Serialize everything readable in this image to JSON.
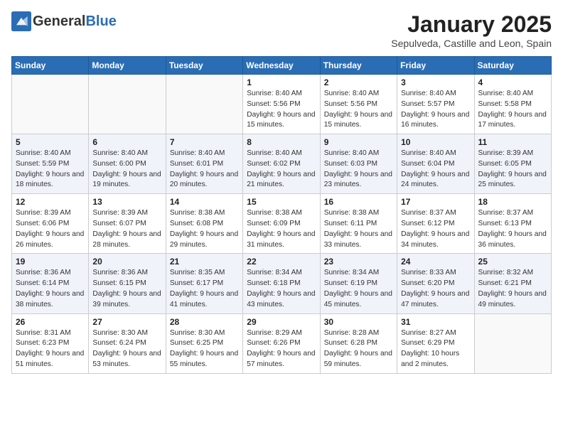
{
  "logo": {
    "general": "General",
    "blue": "Blue"
  },
  "header": {
    "month": "January 2025",
    "location": "Sepulveda, Castille and Leon, Spain"
  },
  "weekdays": [
    "Sunday",
    "Monday",
    "Tuesday",
    "Wednesday",
    "Thursday",
    "Friday",
    "Saturday"
  ],
  "weeks": [
    [
      {
        "day": "",
        "content": ""
      },
      {
        "day": "",
        "content": ""
      },
      {
        "day": "",
        "content": ""
      },
      {
        "day": "1",
        "content": "Sunrise: 8:40 AM\nSunset: 5:56 PM\nDaylight: 9 hours and 15 minutes."
      },
      {
        "day": "2",
        "content": "Sunrise: 8:40 AM\nSunset: 5:56 PM\nDaylight: 9 hours and 15 minutes."
      },
      {
        "day": "3",
        "content": "Sunrise: 8:40 AM\nSunset: 5:57 PM\nDaylight: 9 hours and 16 minutes."
      },
      {
        "day": "4",
        "content": "Sunrise: 8:40 AM\nSunset: 5:58 PM\nDaylight: 9 hours and 17 minutes."
      }
    ],
    [
      {
        "day": "5",
        "content": "Sunrise: 8:40 AM\nSunset: 5:59 PM\nDaylight: 9 hours and 18 minutes."
      },
      {
        "day": "6",
        "content": "Sunrise: 8:40 AM\nSunset: 6:00 PM\nDaylight: 9 hours and 19 minutes."
      },
      {
        "day": "7",
        "content": "Sunrise: 8:40 AM\nSunset: 6:01 PM\nDaylight: 9 hours and 20 minutes."
      },
      {
        "day": "8",
        "content": "Sunrise: 8:40 AM\nSunset: 6:02 PM\nDaylight: 9 hours and 21 minutes."
      },
      {
        "day": "9",
        "content": "Sunrise: 8:40 AM\nSunset: 6:03 PM\nDaylight: 9 hours and 23 minutes."
      },
      {
        "day": "10",
        "content": "Sunrise: 8:40 AM\nSunset: 6:04 PM\nDaylight: 9 hours and 24 minutes."
      },
      {
        "day": "11",
        "content": "Sunrise: 8:39 AM\nSunset: 6:05 PM\nDaylight: 9 hours and 25 minutes."
      }
    ],
    [
      {
        "day": "12",
        "content": "Sunrise: 8:39 AM\nSunset: 6:06 PM\nDaylight: 9 hours and 26 minutes."
      },
      {
        "day": "13",
        "content": "Sunrise: 8:39 AM\nSunset: 6:07 PM\nDaylight: 9 hours and 28 minutes."
      },
      {
        "day": "14",
        "content": "Sunrise: 8:38 AM\nSunset: 6:08 PM\nDaylight: 9 hours and 29 minutes."
      },
      {
        "day": "15",
        "content": "Sunrise: 8:38 AM\nSunset: 6:09 PM\nDaylight: 9 hours and 31 minutes."
      },
      {
        "day": "16",
        "content": "Sunrise: 8:38 AM\nSunset: 6:11 PM\nDaylight: 9 hours and 33 minutes."
      },
      {
        "day": "17",
        "content": "Sunrise: 8:37 AM\nSunset: 6:12 PM\nDaylight: 9 hours and 34 minutes."
      },
      {
        "day": "18",
        "content": "Sunrise: 8:37 AM\nSunset: 6:13 PM\nDaylight: 9 hours and 36 minutes."
      }
    ],
    [
      {
        "day": "19",
        "content": "Sunrise: 8:36 AM\nSunset: 6:14 PM\nDaylight: 9 hours and 38 minutes."
      },
      {
        "day": "20",
        "content": "Sunrise: 8:36 AM\nSunset: 6:15 PM\nDaylight: 9 hours and 39 minutes."
      },
      {
        "day": "21",
        "content": "Sunrise: 8:35 AM\nSunset: 6:17 PM\nDaylight: 9 hours and 41 minutes."
      },
      {
        "day": "22",
        "content": "Sunrise: 8:34 AM\nSunset: 6:18 PM\nDaylight: 9 hours and 43 minutes."
      },
      {
        "day": "23",
        "content": "Sunrise: 8:34 AM\nSunset: 6:19 PM\nDaylight: 9 hours and 45 minutes."
      },
      {
        "day": "24",
        "content": "Sunrise: 8:33 AM\nSunset: 6:20 PM\nDaylight: 9 hours and 47 minutes."
      },
      {
        "day": "25",
        "content": "Sunrise: 8:32 AM\nSunset: 6:21 PM\nDaylight: 9 hours and 49 minutes."
      }
    ],
    [
      {
        "day": "26",
        "content": "Sunrise: 8:31 AM\nSunset: 6:23 PM\nDaylight: 9 hours and 51 minutes."
      },
      {
        "day": "27",
        "content": "Sunrise: 8:30 AM\nSunset: 6:24 PM\nDaylight: 9 hours and 53 minutes."
      },
      {
        "day": "28",
        "content": "Sunrise: 8:30 AM\nSunset: 6:25 PM\nDaylight: 9 hours and 55 minutes."
      },
      {
        "day": "29",
        "content": "Sunrise: 8:29 AM\nSunset: 6:26 PM\nDaylight: 9 hours and 57 minutes."
      },
      {
        "day": "30",
        "content": "Sunrise: 8:28 AM\nSunset: 6:28 PM\nDaylight: 9 hours and 59 minutes."
      },
      {
        "day": "31",
        "content": "Sunrise: 8:27 AM\nSunset: 6:29 PM\nDaylight: 10 hours and 2 minutes."
      },
      {
        "day": "",
        "content": ""
      }
    ]
  ]
}
